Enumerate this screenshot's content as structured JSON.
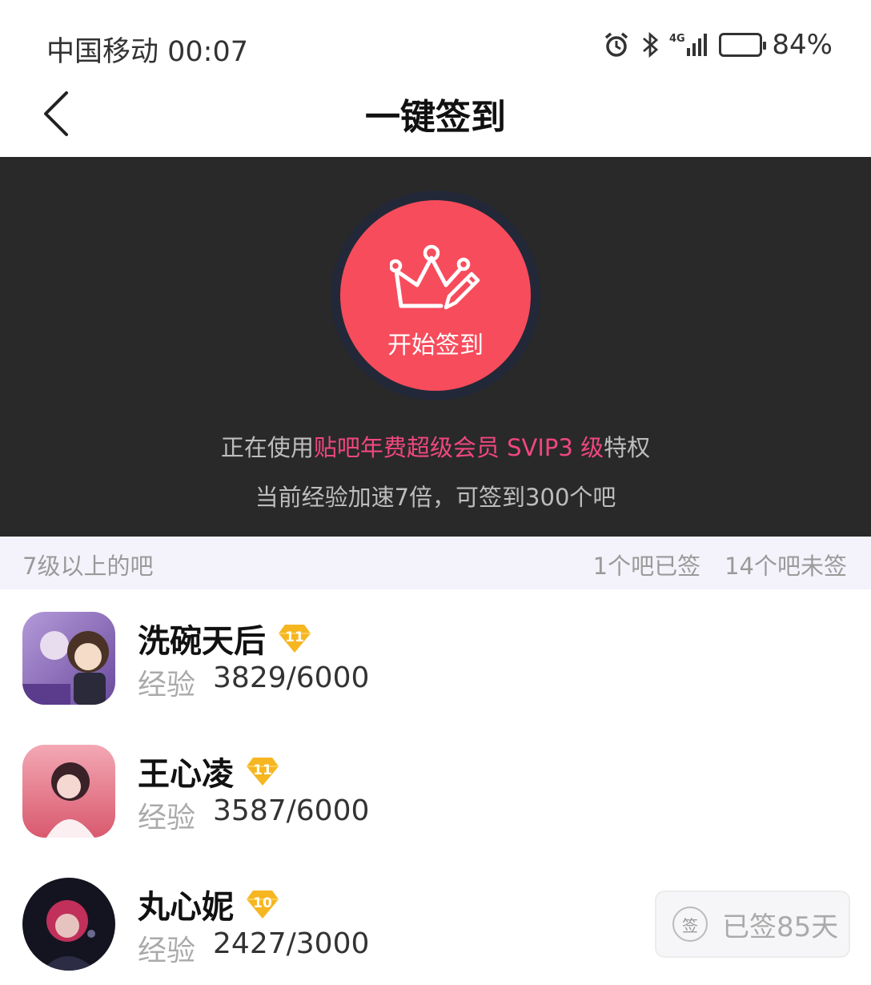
{
  "status_bar": {
    "carrier_time": "中国移动 00:07",
    "network": "4G",
    "battery": "84%",
    "battery_level": 0.84,
    "icons": [
      "alarm-icon",
      "bluetooth-icon",
      "signal-icon",
      "battery-icon"
    ]
  },
  "nav": {
    "title": "一键签到",
    "back_icon": "chevron-left-icon"
  },
  "hero": {
    "sign_button_label": "开始签到",
    "sign_icon": "crown-pen-icon",
    "privilege_prefix": "正在使用",
    "privilege_highlight": "贴吧年费超级会员 SVIP3 级",
    "privilege_suffix": "特权",
    "speed_text": "当前经验加速7倍，可签到300个吧",
    "colors": {
      "button": "#f74c5c",
      "highlight": "#f0477e",
      "background": "#292929"
    }
  },
  "section": {
    "title": "7级以上的吧",
    "signed_count": "1个吧已签",
    "unsigned_count": "14个吧未签"
  },
  "forums": [
    {
      "name": "洗碗天后",
      "level": "11",
      "exp_label": "经验",
      "exp_value": "3829/6000"
    },
    {
      "name": "王心凌",
      "level": "11",
      "exp_label": "经验",
      "exp_value": "3587/6000"
    },
    {
      "name": "丸心妮",
      "level": "10",
      "exp_label": "经验",
      "exp_value": "2427/3000"
    }
  ],
  "signed_pill": {
    "icon_text": "签",
    "label": "已签85天"
  }
}
